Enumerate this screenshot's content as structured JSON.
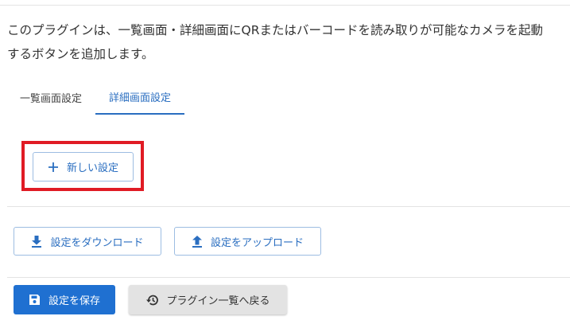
{
  "description": {
    "line1": "このプラグインは、一覧画面・詳細画面にQRまたはバーコードを読み取りが可能なカメラを起動",
    "line2": "するボタンを追加します。"
  },
  "tabs": [
    {
      "label": "一覧画面設定",
      "active": false
    },
    {
      "label": "詳細画面設定",
      "active": true
    }
  ],
  "new_setting": {
    "label": "新しい設定",
    "icon": "plus-icon"
  },
  "download": {
    "label": "設定をダウンロード",
    "icon": "download-icon"
  },
  "upload": {
    "label": "設定をアップロード",
    "icon": "upload-icon"
  },
  "save": {
    "label": "設定を保存",
    "icon": "save-icon"
  },
  "back": {
    "label": "プラグイン一覧へ戻る",
    "icon": "history-back-icon"
  },
  "colors": {
    "primary": "#1f70d1",
    "outline": "#9dbde2",
    "highlight": "#e01b24",
    "secondary_bg": "#e3e3e3"
  }
}
